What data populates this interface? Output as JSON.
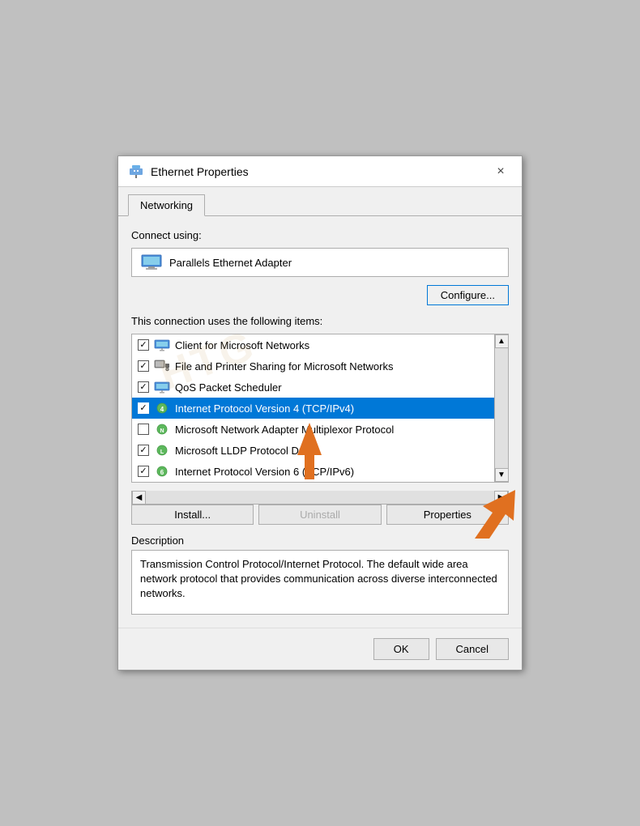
{
  "window": {
    "title": "Ethernet Properties",
    "close_label": "×"
  },
  "tabs": [
    {
      "label": "Networking",
      "active": true
    }
  ],
  "connect_using_label": "Connect using:",
  "adapter": {
    "name": "Parallels Ethernet Adapter"
  },
  "configure_label": "Configure...",
  "items_label": "This connection uses the following items:",
  "list_items": [
    {
      "id": 0,
      "checked": true,
      "label": "Client for Microsoft Networks",
      "icon_type": "network"
    },
    {
      "id": 1,
      "checked": true,
      "label": "File and Printer Sharing for Microsoft Networks",
      "icon_type": "network"
    },
    {
      "id": 2,
      "checked": true,
      "label": "QoS Packet Scheduler",
      "icon_type": "network"
    },
    {
      "id": 3,
      "checked": true,
      "label": "Internet Protocol Version 4 (TCP/IPv4)",
      "icon_type": "protocol",
      "selected": true
    },
    {
      "id": 4,
      "checked": false,
      "label": "Microsoft Network Adapter Multiplexor Protocol",
      "icon_type": "protocol"
    },
    {
      "id": 5,
      "checked": true,
      "label": "Microsoft LLDP Protocol Driver",
      "icon_type": "protocol"
    },
    {
      "id": 6,
      "checked": true,
      "label": "Internet Protocol Version 6 (TCP/IPv6)",
      "icon_type": "protocol"
    }
  ],
  "buttons": {
    "install": "Install...",
    "uninstall": "Uninstall",
    "properties": "Properties"
  },
  "description": {
    "label": "Description",
    "text": "Transmission Control Protocol/Internet Protocol. The default wide area network protocol that provides communication across diverse interconnected networks."
  },
  "footer": {
    "ok": "OK",
    "cancel": "Cancel"
  }
}
